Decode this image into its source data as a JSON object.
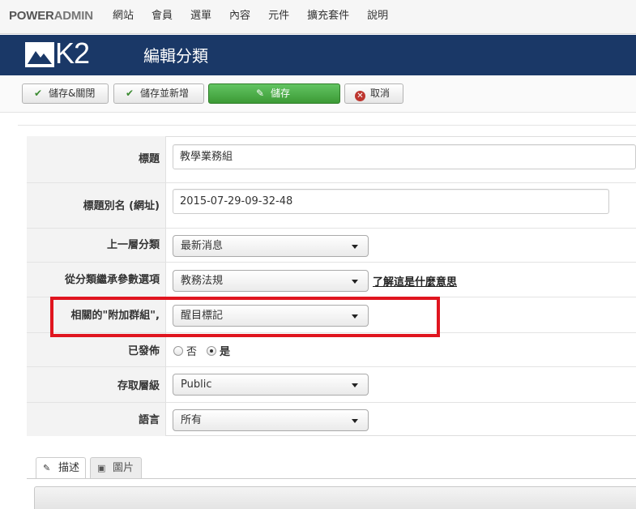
{
  "topbar": {
    "brand_a": "POWER",
    "brand_b": "ADMIN",
    "menu": [
      "網站",
      "會員",
      "選單",
      "內容",
      "元件",
      "擴充套件",
      "說明"
    ]
  },
  "header": {
    "logo_text": "K2",
    "title": "編輯分類",
    "band_color": "#1a3867"
  },
  "toolbar": {
    "save_close": "儲存&關閉",
    "save_new": "儲存並新增",
    "save": "儲存",
    "cancel": "取消"
  },
  "form": {
    "title_label": "標題",
    "title_value": "教學業務組",
    "alias_label": "標題別名 (網址)",
    "alias_value": "2015-07-29-09-32-48",
    "parent_label": "上一層分類",
    "parent_value": "最新消息",
    "inherit_label": "從分類繼承參數選項",
    "inherit_value": "教務法規",
    "inherit_help": "了解這是什麼意思",
    "extra_label": "相關的\"附加群組\",",
    "extra_value": "醒目標記",
    "published_label": "已發佈",
    "published_no": "否",
    "published_yes": "是",
    "access_label": "存取層級",
    "access_value": "Public",
    "language_label": "語言",
    "language_value": "所有"
  },
  "tabs": {
    "description": "描述",
    "image": "圖片"
  },
  "highlight_color": "#e0151f"
}
